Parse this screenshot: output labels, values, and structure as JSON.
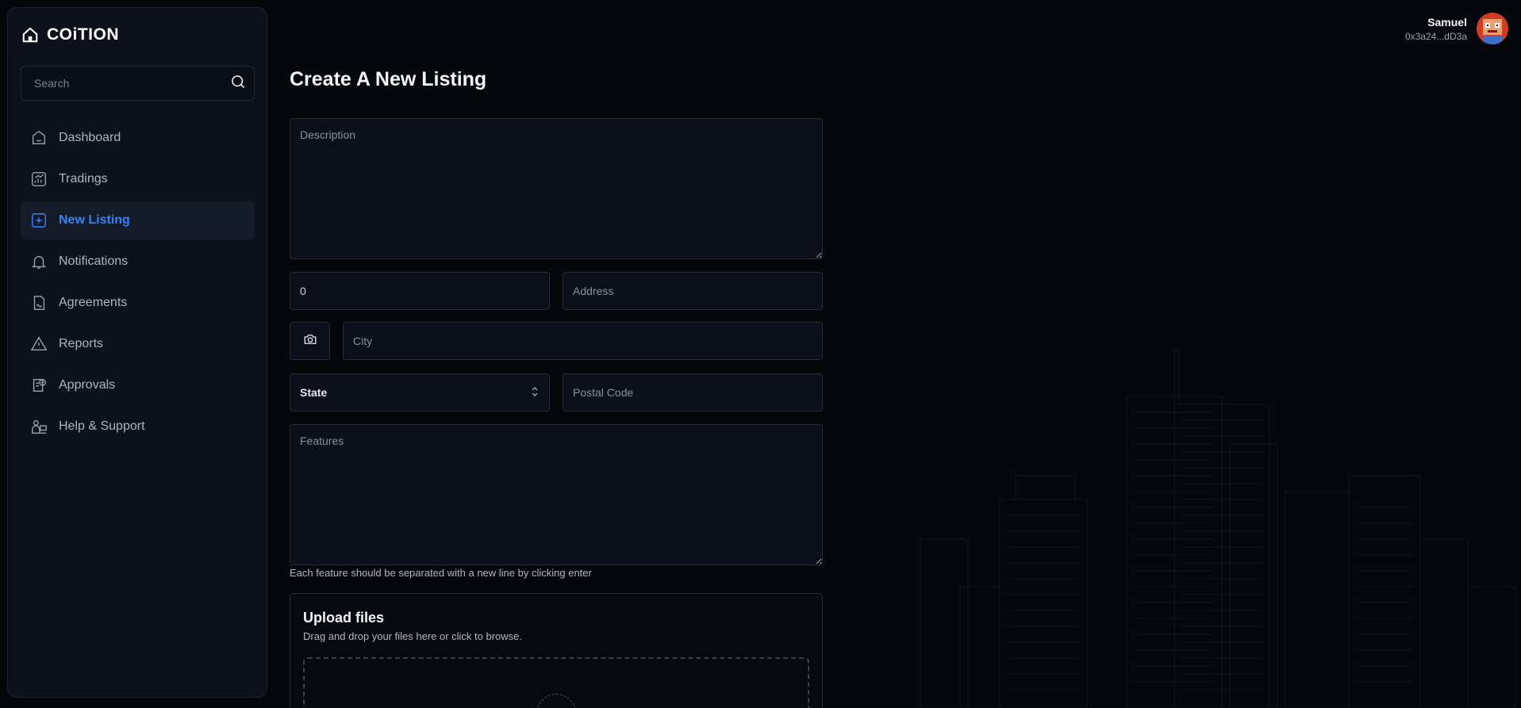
{
  "brand": {
    "name": "COiTION",
    "icon": "home-icon"
  },
  "search": {
    "placeholder": "Search",
    "icon": "search-icon"
  },
  "nav": {
    "items": [
      {
        "label": "Dashboard",
        "icon": "dashboard-icon",
        "active": false
      },
      {
        "label": "Tradings",
        "icon": "chart-icon",
        "active": false
      },
      {
        "label": "New Listing",
        "icon": "plus-square-icon",
        "active": true
      },
      {
        "label": "Notifications",
        "icon": "bell-icon",
        "active": false
      },
      {
        "label": "Agreements",
        "icon": "document-sign-icon",
        "active": false
      },
      {
        "label": "Reports",
        "icon": "warning-icon",
        "active": false
      },
      {
        "label": "Approvals",
        "icon": "approval-icon",
        "active": false
      },
      {
        "label": "Help & Support",
        "icon": "support-icon",
        "active": false
      }
    ]
  },
  "user": {
    "name": "Samuel",
    "address": "0x3a24...dD3a"
  },
  "page": {
    "title": "Create A New Listing"
  },
  "form": {
    "description": {
      "placeholder": "Description",
      "value": ""
    },
    "price": {
      "value": "0"
    },
    "address": {
      "placeholder": "Address",
      "value": ""
    },
    "city": {
      "placeholder": "City",
      "value": ""
    },
    "state": {
      "selected": "State"
    },
    "postal_code": {
      "placeholder": "Postal Code",
      "value": ""
    },
    "features": {
      "placeholder": "Features",
      "value": ""
    },
    "features_hint": "Each feature should be separated with a new line by clicking enter"
  },
  "upload": {
    "title": "Upload files",
    "subtitle": "Drag and drop your files here or click to browse."
  },
  "colors": {
    "background": "#05070d",
    "sidebar": "#0c111c",
    "accent": "#3b82f6",
    "field_bg": "#0b0f19",
    "border": "#252c3a"
  }
}
